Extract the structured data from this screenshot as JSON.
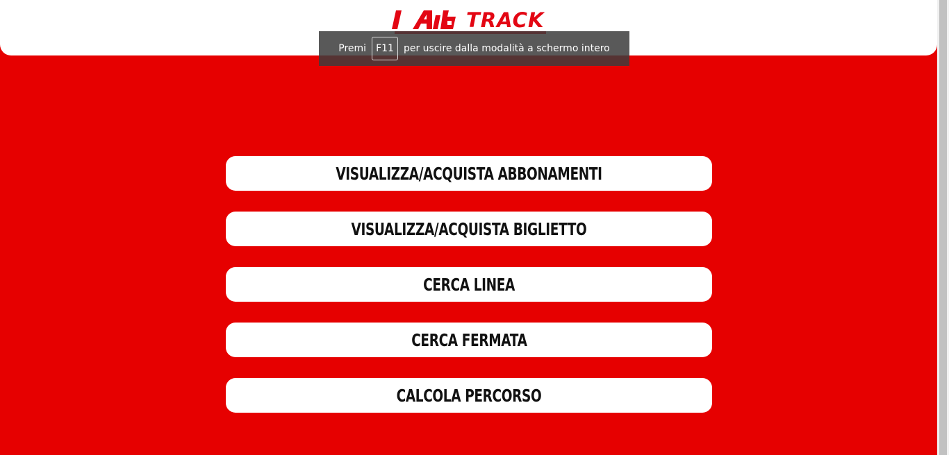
{
  "brand": {
    "logo_text": "TRACK",
    "colors": {
      "primary_red": "#e60000",
      "logo_red": "#e30613",
      "button_bg": "#ffffff",
      "button_text": "#111111"
    }
  },
  "fullscreen_toast": {
    "prefix": "Premi",
    "key": "F11",
    "suffix": "per uscire dalla modalità a schermo intero"
  },
  "menu": {
    "items": [
      {
        "label": "VISUALIZZA/ACQUISTA ABBONAMENTI"
      },
      {
        "label": "VISUALIZZA/ACQUISTA BIGLIETTO"
      },
      {
        "label": "CERCA LINEA"
      },
      {
        "label": "CERCA FERMATA"
      },
      {
        "label": "CALCOLA PERCORSO"
      }
    ]
  }
}
